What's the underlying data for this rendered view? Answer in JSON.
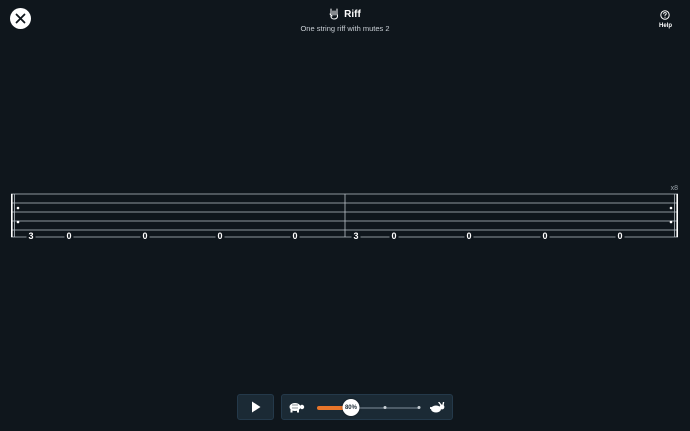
{
  "header": {
    "title": "Riff",
    "subtitle": "One string riff with mutes 2",
    "title_icon": "rock-hand-icon"
  },
  "close": {
    "icon": "close-icon"
  },
  "help": {
    "label": "Help",
    "icon": "question-icon"
  },
  "tab": {
    "repeat": "x8",
    "measures": [
      {
        "notes": [
          "3",
          "0",
          "0",
          "0",
          "0"
        ]
      },
      {
        "notes": [
          "3",
          "0",
          "0",
          "0",
          "0"
        ]
      }
    ]
  },
  "controls": {
    "play_icon": "play-icon",
    "slow_icon": "turtle-icon",
    "fast_icon": "rabbit-icon",
    "tempo": {
      "value": 80,
      "label": "80%"
    }
  },
  "colors": {
    "background": "#0f161c",
    "panel": "#1b2a35",
    "accent": "#e8752a"
  }
}
